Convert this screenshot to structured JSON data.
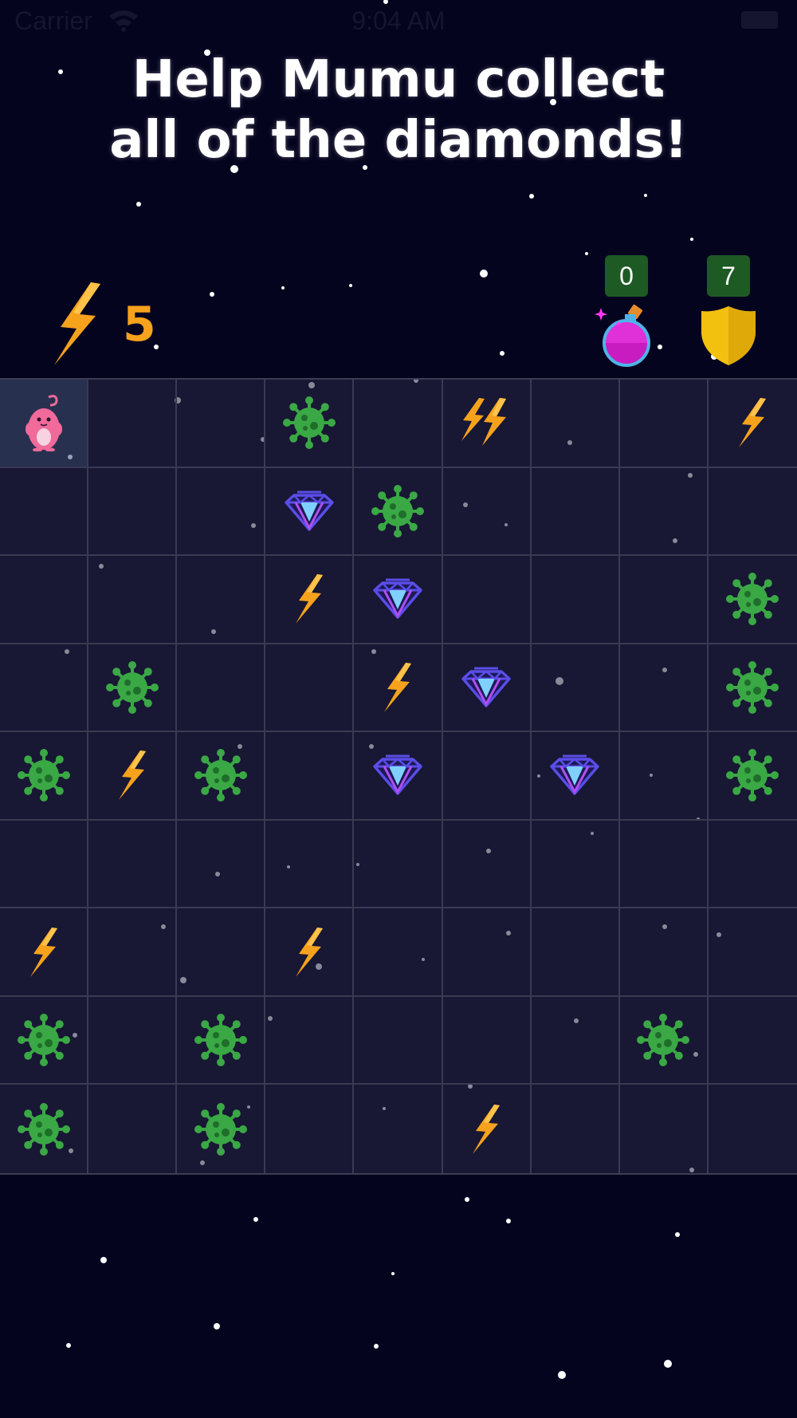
{
  "status_bar": {
    "carrier": "Carrier",
    "time": "9:04 AM"
  },
  "title": {
    "line1": "Help Mumu collect",
    "line2": "all of the diamonds!"
  },
  "energy": {
    "count": "5",
    "icon": "lightning-bolt-icon"
  },
  "inventory": [
    {
      "name": "potion",
      "icon": "magic-potion-icon",
      "count": "0"
    },
    {
      "name": "shield",
      "icon": "shield-icon",
      "count": "7"
    }
  ],
  "colors": {
    "background": "#05041f",
    "cell": "#1f1f3a",
    "bolt": "#f6a21c",
    "virus": "#3aa845",
    "diamond": "#5a4de8",
    "badge": "#1e5a24",
    "shield": "#f2c00f",
    "potion": "#e030d8"
  },
  "board": {
    "rows": 9,
    "cols": 9,
    "legend": {
      "P": "player-mumu",
      "V": "virus",
      "D": "diamond",
      "B": "bolt",
      "BB": "double-bolt",
      "": "empty"
    },
    "grid": [
      [
        "P",
        "",
        "",
        "V",
        "",
        "BB",
        "",
        "",
        "B"
      ],
      [
        "",
        "",
        "",
        "D",
        "V",
        "",
        "",
        "",
        ""
      ],
      [
        "",
        "",
        "",
        "B",
        "D",
        "",
        "",
        "",
        "V"
      ],
      [
        "",
        "V",
        "",
        "",
        "B",
        "D",
        "",
        "",
        "V"
      ],
      [
        "V",
        "B",
        "V",
        "",
        "D",
        "",
        "D",
        "",
        "V"
      ],
      [
        "",
        "",
        "",
        "",
        "",
        "",
        "",
        "",
        ""
      ],
      [
        "B",
        "",
        "",
        "B",
        "",
        "",
        "",
        "",
        ""
      ],
      [
        "V",
        "",
        "V",
        "",
        "",
        "",
        "",
        "V",
        ""
      ],
      [
        "V",
        "",
        "V",
        "",
        "",
        "B",
        "",
        "",
        ""
      ]
    ]
  }
}
